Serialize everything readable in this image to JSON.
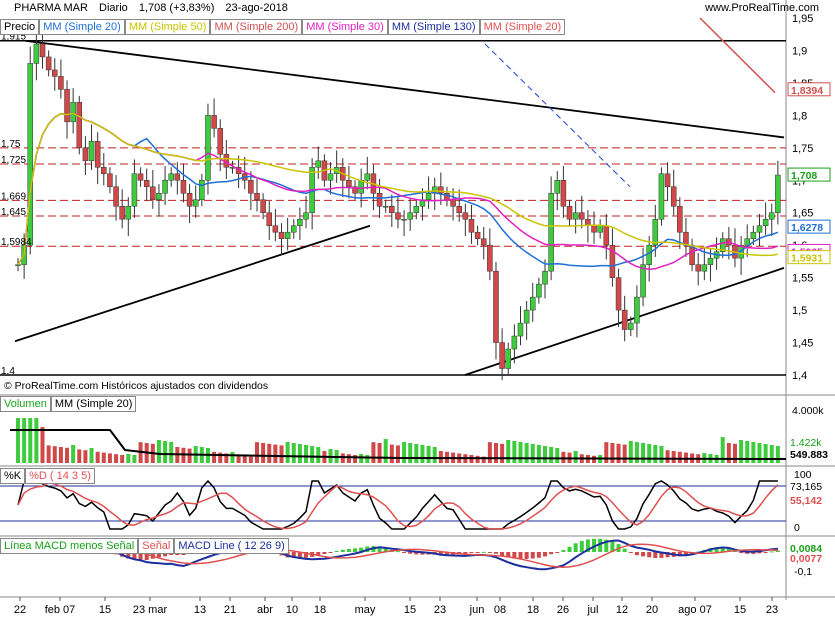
{
  "header": {
    "instrument": "PHARMA MAR",
    "period": "Diario",
    "last": "1,708 (+3,83%)",
    "date": "23-ago-2018",
    "site": "www.ProRealTime.com"
  },
  "price_legend": [
    {
      "label": "Precio",
      "color": "#000000"
    },
    {
      "label": "MM (Simple 20)",
      "color": "#1f6fd6"
    },
    {
      "label": "MM (Simple 50)",
      "color": "#c9c400"
    },
    {
      "label": "MM (Simple 200)",
      "color": "#d05050"
    },
    {
      "label": "MM (Simple 30)",
      "color": "#e020c0"
    },
    {
      "label": "MM (Simple 130)",
      "color": "#1c2f9c"
    },
    {
      "label": "MM (Simple 20)",
      "color": "#e05050"
    }
  ],
  "copyright": "© ProRealTime.com Históricos ajustados con dividendos",
  "volume_legend": [
    {
      "label": "Volumen",
      "color": "#1aa01a"
    },
    {
      "label": "MM (Simple 20)",
      "color": "#000000"
    }
  ],
  "stoch_legend": [
    {
      "label": "%K",
      "color": "#000000"
    },
    {
      "label": "%D ( 14 3 5)",
      "color": "#e05050"
    }
  ],
  "macd_legend": [
    {
      "label": "Línea MACD menos Señal",
      "color": "#1aa01a"
    },
    {
      "label": "Señal",
      "color": "#e05050"
    },
    {
      "label": "MACD Line ( 12 26 9)",
      "color": "#1c2f9c"
    }
  ],
  "price_axis": [
    "1,95",
    "1,9",
    "1,85",
    "1,8",
    "1,75",
    "1,7",
    "1,65",
    "1,6",
    "1,55",
    "1,5",
    "1,45",
    "1,4"
  ],
  "price_left_labels": [
    "1,915",
    "1,75",
    "1,725",
    "1,669",
    "1,645",
    "1,5984",
    "1,4"
  ],
  "price_tags": [
    {
      "text": "1,8394",
      "color": "#d05050"
    },
    {
      "text": "1,708",
      "color": "#1aa01a"
    },
    {
      "text": "1,6278",
      "color": "#1f6fd6"
    },
    {
      "text": "1,5965",
      "color": "#e020c0"
    },
    {
      "text": "1,5931",
      "color": "#c9c400"
    }
  ],
  "volume_axis": [
    "4.000k"
  ],
  "volume_tags": [
    {
      "text": "1.422k",
      "color": "#1aa01a"
    },
    {
      "text": "549.883",
      "color": "#000000"
    }
  ],
  "stoch_axis": [
    "100",
    "0"
  ],
  "stoch_tags": [
    {
      "text": "73,165",
      "color": "#000000"
    },
    {
      "text": "55,142",
      "color": "#e05050"
    }
  ],
  "macd_axis": [
    "-0,1"
  ],
  "macd_tags": [
    {
      "text": "0,0084",
      "color": "#1aa01a"
    },
    {
      "text": "0,0077",
      "color": "#e05050"
    }
  ],
  "x_labels": [
    "22",
    "feb 07",
    "15",
    "23 mar",
    "13",
    "21",
    "abr",
    "10",
    "18",
    "may",
    "15",
    "23",
    "jun",
    "08",
    "18",
    "26",
    "jul",
    "12",
    "20",
    "ago 07",
    "15",
    "23"
  ],
  "chart_data": {
    "type": "candlestick",
    "title": "PHARMA MAR Diario",
    "ylim": [
      1.4,
      1.95
    ],
    "close_approx": [
      1.57,
      1.6,
      1.88,
      1.91,
      1.89,
      1.87,
      1.86,
      1.84,
      1.79,
      1.82,
      1.75,
      1.73,
      1.76,
      1.72,
      1.71,
      1.69,
      1.66,
      1.64,
      1.66,
      1.71,
      1.7,
      1.69,
      1.67,
      1.68,
      1.7,
      1.71,
      1.7,
      1.68,
      1.66,
      1.67,
      1.7,
      1.8,
      1.78,
      1.74,
      1.72,
      1.72,
      1.71,
      1.7,
      1.68,
      1.67,
      1.65,
      1.63,
      1.62,
      1.61,
      1.62,
      1.63,
      1.64,
      1.65,
      1.72,
      1.73,
      1.7,
      1.71,
      1.72,
      1.7,
      1.69,
      1.68,
      1.7,
      1.71,
      1.68,
      1.66,
      1.66,
      1.65,
      1.64,
      1.64,
      1.65,
      1.66,
      1.67,
      1.68,
      1.69,
      1.68,
      1.67,
      1.66,
      1.65,
      1.64,
      1.62,
      1.61,
      1.6,
      1.56,
      1.45,
      1.41,
      1.44,
      1.46,
      1.48,
      1.5,
      1.52,
      1.54,
      1.56,
      1.68,
      1.7,
      1.66,
      1.64,
      1.65,
      1.64,
      1.63,
      1.62,
      1.63,
      1.6,
      1.55,
      1.5,
      1.47,
      1.48,
      1.52,
      1.57,
      1.6,
      1.64,
      1.71,
      1.69,
      1.66,
      1.62,
      1.6,
      1.57,
      1.56,
      1.57,
      1.58,
      1.59,
      1.61,
      1.6,
      1.58,
      1.6,
      1.61,
      1.62,
      1.63,
      1.64,
      1.65,
      1.708
    ]
  }
}
